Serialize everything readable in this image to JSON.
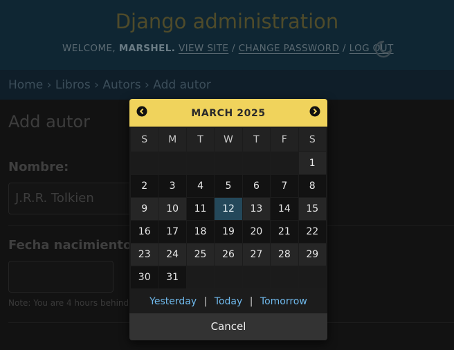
{
  "header": {
    "site_title": "Django administration",
    "welcome": "WELCOME,",
    "username": "MARSHEL.",
    "view_site": "VIEW SITE",
    "change_password": "CHANGE PASSWORD",
    "log_out": "LOG OUT",
    "sep1": "/",
    "sep2": "/",
    "theme_icon": "moon-icon"
  },
  "breadcrumbs": {
    "home": "Home",
    "app": "Libros",
    "model": "Autors",
    "current": "Add autor",
    "separator": "›"
  },
  "form": {
    "heading": "Add autor",
    "nombre_label": "Nombre:",
    "nombre_value": "J.R.R. Tolkien",
    "fecha_label": "Fecha nacimiento:",
    "fecha_value": "",
    "timezone_note": "Note: You are 4 hours behind"
  },
  "calendar": {
    "caption": "MARCH 2025",
    "prev_icon": "chevron-left-circle-icon",
    "next_icon": "chevron-right-circle-icon",
    "weekdays": [
      "S",
      "M",
      "T",
      "W",
      "T",
      "F",
      "S"
    ],
    "weeks": [
      [
        "",
        "",
        "",
        "",
        "",
        "",
        "1"
      ],
      [
        "2",
        "3",
        "4",
        "5",
        "6",
        "7",
        "8"
      ],
      [
        "9",
        "10",
        "11",
        "12",
        "13",
        "14",
        "15"
      ],
      [
        "16",
        "17",
        "18",
        "19",
        "20",
        "21",
        "22"
      ],
      [
        "23",
        "24",
        "25",
        "26",
        "27",
        "28",
        "29"
      ],
      [
        "30",
        "31",
        "",
        "",
        "",
        "",
        ""
      ]
    ],
    "today": "12",
    "shortcuts": {
      "yesterday": "Yesterday",
      "today": "Today",
      "tomorrow": "Tomorrow",
      "sep": "|"
    },
    "cancel": "Cancel"
  },
  "colors": {
    "header_bg": "#0f2633",
    "caption_bg": "#f0d35c",
    "today_bg": "#24485a",
    "link": "#6fb9ec"
  }
}
